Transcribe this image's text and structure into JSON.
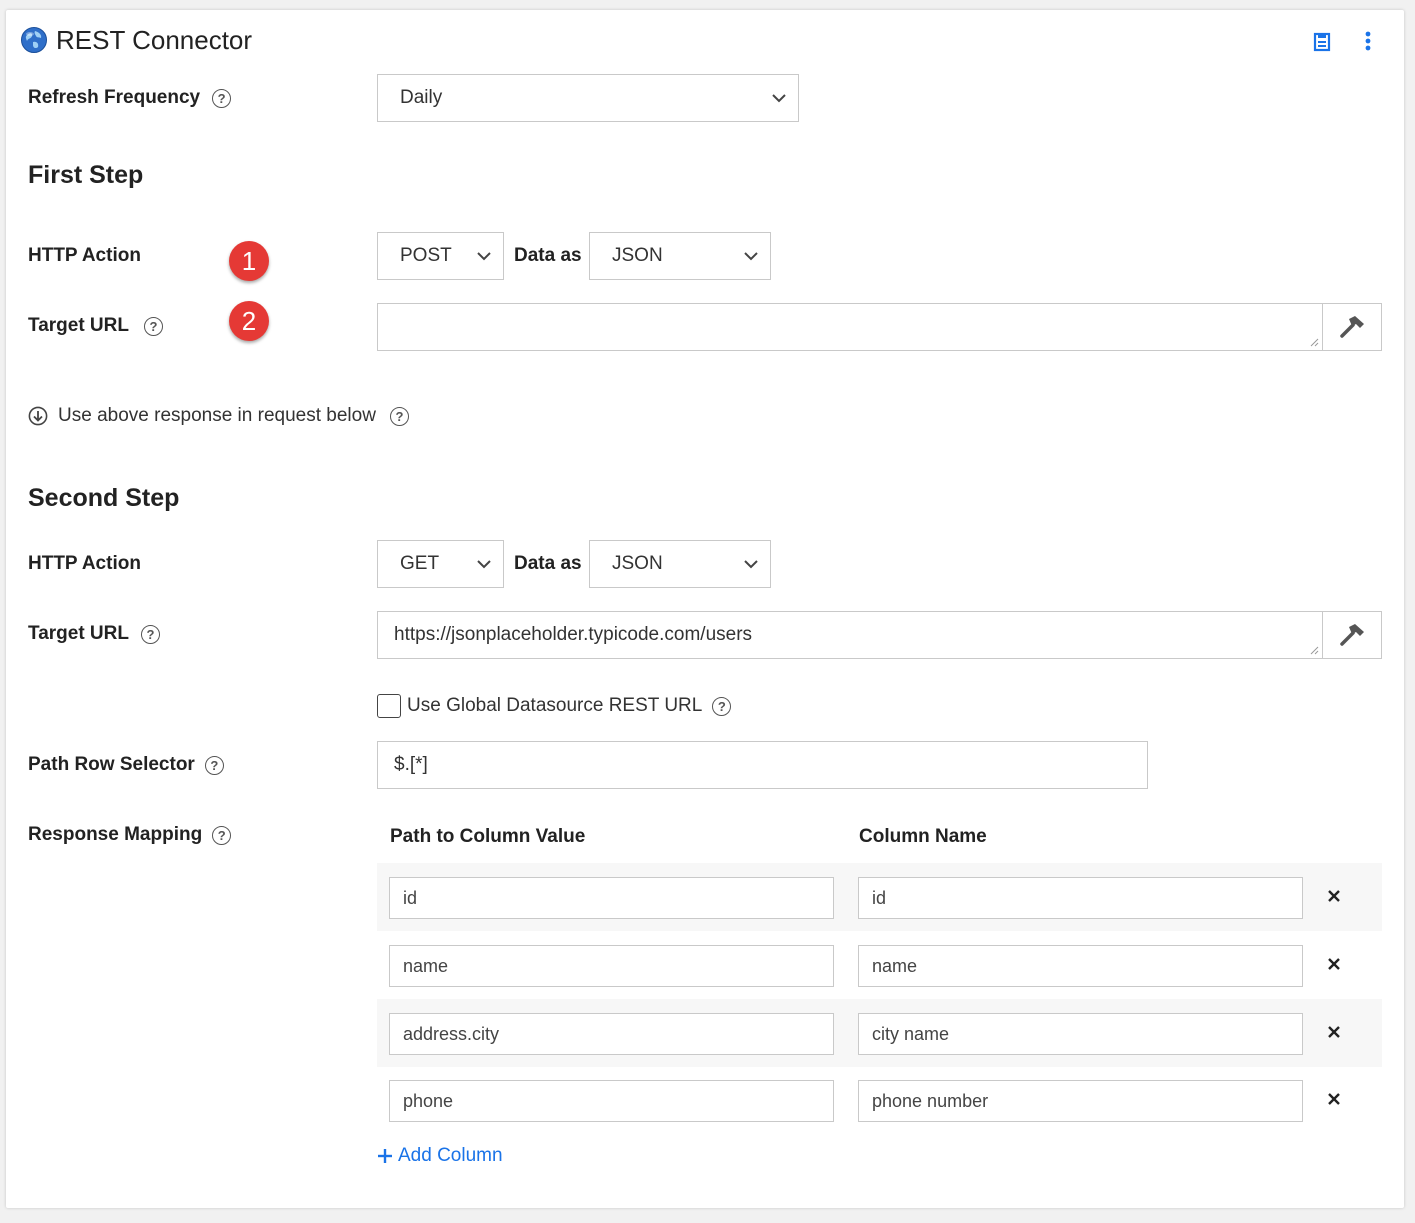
{
  "header": {
    "title": "REST Connector",
    "icons": [
      "globe-icon",
      "save-icon",
      "more-vertical-icon"
    ],
    "accent_color": "#1a73e8"
  },
  "refresh": {
    "label": "Refresh Frequency",
    "value": "Daily"
  },
  "first_step": {
    "title": "First Step",
    "http_action_label": "HTTP Action",
    "http_action_value": "POST",
    "data_as_label": "Data as",
    "data_as_value": "JSON",
    "target_url_label": "Target URL",
    "target_url_value": "",
    "badge_1": "1",
    "badge_2": "2",
    "badge_color": "#e53935"
  },
  "use_response": {
    "label": "Use above response in request below"
  },
  "second_step": {
    "title": "Second Step",
    "http_action_label": "HTTP Action",
    "http_action_value": "GET",
    "data_as_label": "Data as",
    "data_as_value": "JSON",
    "target_url_label": "Target URL",
    "target_url_value": "https://jsonplaceholder.typicode.com/users",
    "global_checkbox_label": "Use Global Datasource REST URL",
    "global_checkbox_checked": false,
    "path_row_label": "Path Row Selector",
    "path_row_value": "$.[*]",
    "mapping_label": "Response Mapping",
    "col_path_header": "Path to Column Value",
    "col_name_header": "Column Name",
    "rows": [
      {
        "path": "id",
        "name": "id"
      },
      {
        "path": "name",
        "name": "name"
      },
      {
        "path": "address.city",
        "name": "city name"
      },
      {
        "path": "phone",
        "name": "phone number"
      }
    ],
    "add_column_label": "Add Column"
  }
}
